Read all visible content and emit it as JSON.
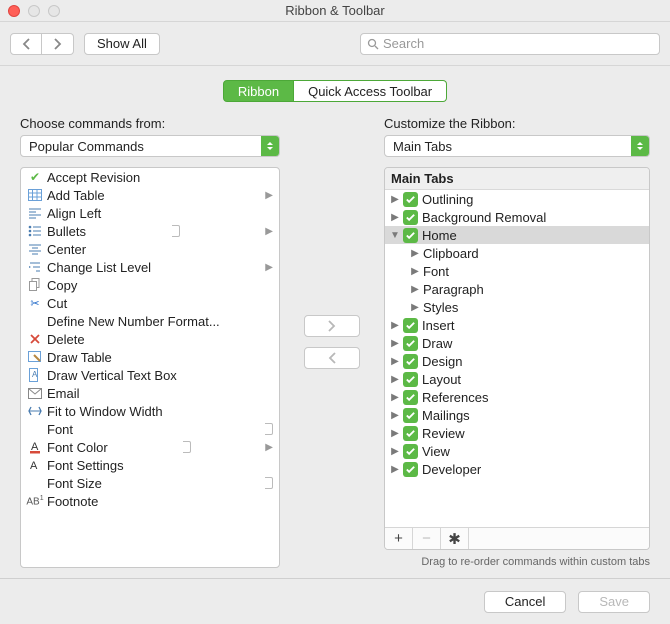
{
  "window": {
    "title": "Ribbon & Toolbar"
  },
  "toolbar": {
    "show_all": "Show All",
    "search_placeholder": "Search"
  },
  "segmented": {
    "ribbon": "Ribbon",
    "qat": "Quick Access Toolbar"
  },
  "left": {
    "label": "Choose commands from:",
    "dropdown": "Popular Commands",
    "items": [
      {
        "icon": "accept",
        "label": "Accept Revision"
      },
      {
        "icon": "table",
        "label": "Add Table",
        "sub": true
      },
      {
        "icon": "alignleft",
        "label": "Align Left"
      },
      {
        "icon": "bullets",
        "label": "Bullets",
        "sub": true,
        "ind": true
      },
      {
        "icon": "center",
        "label": "Center"
      },
      {
        "icon": "listlevel",
        "label": "Change List Level",
        "sub": true
      },
      {
        "icon": "copy",
        "label": "Copy"
      },
      {
        "icon": "cut",
        "label": "Cut"
      },
      {
        "icon": "none",
        "label": "Define New Number Format..."
      },
      {
        "icon": "delete",
        "label": "Delete"
      },
      {
        "icon": "drawtable",
        "label": "Draw Table"
      },
      {
        "icon": "vtextbox",
        "label": "Draw Vertical Text Box"
      },
      {
        "icon": "email",
        "label": "Email"
      },
      {
        "icon": "fit",
        "label": "Fit to Window Width"
      },
      {
        "icon": "none",
        "label": "Font",
        "ind": true
      },
      {
        "icon": "fontcolor",
        "label": "Font Color",
        "sub": true,
        "ind": true
      },
      {
        "icon": "fontsettings",
        "label": "Font Settings"
      },
      {
        "icon": "none",
        "label": "Font Size",
        "ind": true
      },
      {
        "icon": "footnote",
        "label": "Footnote"
      }
    ]
  },
  "right": {
    "label": "Customize the Ribbon:",
    "dropdown": "Main Tabs",
    "header": "Main Tabs",
    "tree": [
      {
        "label": "Outlining",
        "checked": true,
        "disc": "right"
      },
      {
        "label": "Background Removal",
        "checked": true,
        "disc": "right"
      },
      {
        "label": "Home",
        "checked": true,
        "disc": "down",
        "sel": true,
        "children": [
          {
            "label": "Clipboard"
          },
          {
            "label": "Font"
          },
          {
            "label": "Paragraph"
          },
          {
            "label": "Styles"
          }
        ]
      },
      {
        "label": "Insert",
        "checked": true,
        "disc": "right"
      },
      {
        "label": "Draw",
        "checked": true,
        "disc": "right"
      },
      {
        "label": "Design",
        "checked": true,
        "disc": "right"
      },
      {
        "label": "Layout",
        "checked": true,
        "disc": "right"
      },
      {
        "label": "References",
        "checked": true,
        "disc": "right"
      },
      {
        "label": "Mailings",
        "checked": true,
        "disc": "right"
      },
      {
        "label": "Review",
        "checked": true,
        "disc": "right"
      },
      {
        "label": "View",
        "checked": true,
        "disc": "right"
      },
      {
        "label": "Developer",
        "checked": true,
        "disc": "right"
      }
    ],
    "hint": "Drag to re-order commands within custom tabs"
  },
  "footer": {
    "cancel": "Cancel",
    "save": "Save"
  }
}
